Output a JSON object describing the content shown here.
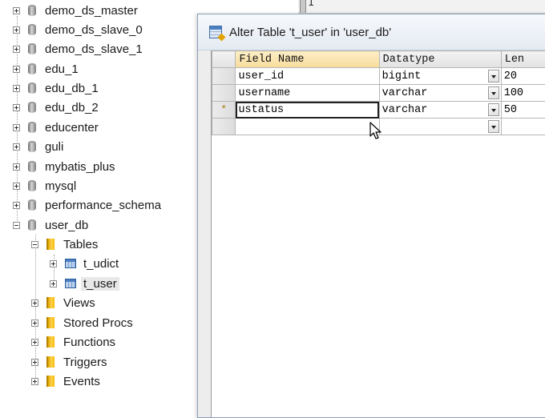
{
  "tree": {
    "databases": [
      "demo_ds_master",
      "demo_ds_slave_0",
      "demo_ds_slave_1",
      "edu_1",
      "edu_db_1",
      "edu_db_2",
      "educenter",
      "guli",
      "mybatis_plus",
      "mysql",
      "performance_schema",
      "user_db"
    ],
    "folders": {
      "tables": "Tables",
      "views": "Views",
      "stored_procs": "Stored Procs",
      "functions": "Functions",
      "triggers": "Triggers",
      "events": "Events"
    },
    "tables": [
      "t_udict",
      "t_user"
    ]
  },
  "editor": {
    "line_number": "1"
  },
  "dialog": {
    "title": "Alter Table 't_user' in 'user_db'",
    "columns": {
      "field_name": "Field Name",
      "datatype": "Datatype",
      "len": "Len"
    },
    "rows": [
      {
        "marker": "",
        "field": "user_id",
        "datatype": "bigint",
        "len": "20"
      },
      {
        "marker": "",
        "field": "username",
        "datatype": "varchar",
        "len": "100"
      },
      {
        "marker": "*",
        "field": "ustatus",
        "datatype": "varchar",
        "len": "50"
      },
      {
        "marker": "",
        "field": "",
        "datatype": "",
        "len": ""
      }
    ]
  },
  "colors": {
    "folder": "#f5b800",
    "selection": "#e8e8e8",
    "header_active": "#f7dc9c"
  }
}
